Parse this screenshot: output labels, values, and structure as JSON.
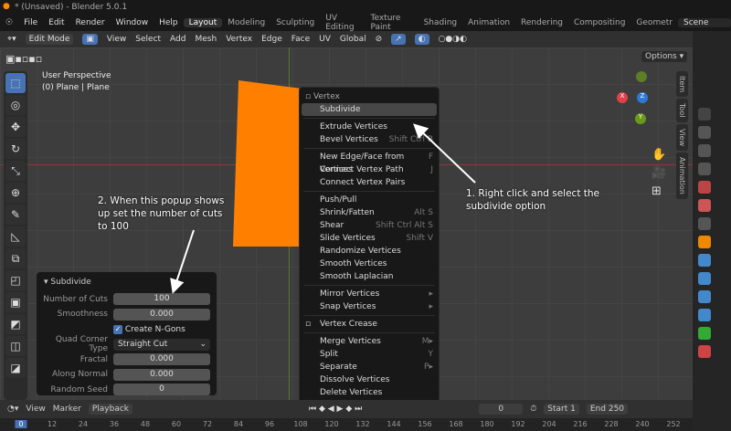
{
  "title": "* (Unsaved) - Blender 5.0.1",
  "menu": [
    "File",
    "Edit",
    "Render",
    "Window",
    "Help"
  ],
  "workspaces": [
    "Layout",
    "Modeling",
    "Sculpting",
    "UV Editing",
    "Texture Paint",
    "Shading",
    "Animation",
    "Rendering",
    "Compositing",
    "Geometr"
  ],
  "scene": "Scene",
  "header": {
    "mode": "Edit Mode",
    "menus": [
      "View",
      "Select",
      "Add",
      "Mesh",
      "Vertex",
      "Edge",
      "Face",
      "UV"
    ],
    "orientation": "Global",
    "options": "Options",
    "axes": [
      "X",
      "Y",
      "Z"
    ]
  },
  "viewport": {
    "perspective": "User Perspective",
    "object": "(0) Plane | Plane"
  },
  "ntabs": [
    "Item",
    "Tool",
    "View",
    "Animation"
  ],
  "context_menu": {
    "title": "Vertex",
    "items": [
      {
        "label": "Subdivide",
        "shortcut": "",
        "hl": true
      },
      {
        "sep": true
      },
      {
        "label": "Extrude Vertices",
        "shortcut": ""
      },
      {
        "label": "Bevel Vertices",
        "shortcut": "Shift Ctrl B"
      },
      {
        "sep": true
      },
      {
        "label": "New Edge/Face from Vertices",
        "shortcut": "F"
      },
      {
        "label": "Connect Vertex Path",
        "shortcut": "J"
      },
      {
        "label": "Connect Vertex Pairs",
        "shortcut": ""
      },
      {
        "sep": true
      },
      {
        "label": "Push/Pull",
        "shortcut": ""
      },
      {
        "label": "Shrink/Fatten",
        "shortcut": "Alt S"
      },
      {
        "label": "Shear",
        "shortcut": "Shift Ctrl Alt S"
      },
      {
        "label": "Slide Vertices",
        "shortcut": "Shift V"
      },
      {
        "label": "Randomize Vertices",
        "shortcut": ""
      },
      {
        "label": "Smooth Vertices",
        "shortcut": ""
      },
      {
        "label": "Smooth Laplacian",
        "shortcut": ""
      },
      {
        "sep": true
      },
      {
        "label": "Mirror Vertices",
        "shortcut": "▸"
      },
      {
        "label": "Snap Vertices",
        "shortcut": "▸"
      },
      {
        "sep": true
      },
      {
        "label": "Vertex Crease",
        "shortcut": "",
        "icon": true
      },
      {
        "sep": true
      },
      {
        "label": "Merge Vertices",
        "shortcut": "M▸"
      },
      {
        "label": "Split",
        "shortcut": "Y"
      },
      {
        "label": "Separate",
        "shortcut": "P▸"
      },
      {
        "label": "Dissolve Vertices",
        "shortcut": ""
      },
      {
        "label": "Delete Vertices",
        "shortcut": ""
      }
    ]
  },
  "subdivide": {
    "title": "Subdivide",
    "number_of_cuts_label": "Number of Cuts",
    "number_of_cuts": "100",
    "smoothness_label": "Smoothness",
    "smoothness": "0.000",
    "create_ngons": "Create N-Gons",
    "quad_corner_label": "Quad Corner Type",
    "quad_corner": "Straight Cut",
    "fractal_label": "Fractal",
    "fractal": "0.000",
    "along_normal_label": "Along Normal",
    "along_normal": "0.000",
    "random_seed_label": "Random Seed",
    "random_seed": "0"
  },
  "notes": {
    "one": "1. Right click and select the subdivide option",
    "two": "2. When this popup shows up set the number of cuts to 100"
  },
  "timeline": {
    "menus": [
      "View",
      "Marker",
      "Playback"
    ],
    "current": "0",
    "start_label": "Start",
    "start": "1",
    "end_label": "End",
    "end": "250"
  },
  "ruler": [
    "0",
    "12",
    "24",
    "36",
    "48",
    "60",
    "72",
    "84",
    "96",
    "108",
    "120",
    "132",
    "144",
    "156",
    "168",
    "180",
    "192",
    "204",
    "216",
    "228",
    "240",
    "252"
  ],
  "colors": {
    "accent": "#4772b3",
    "plane": "#ff8000"
  }
}
